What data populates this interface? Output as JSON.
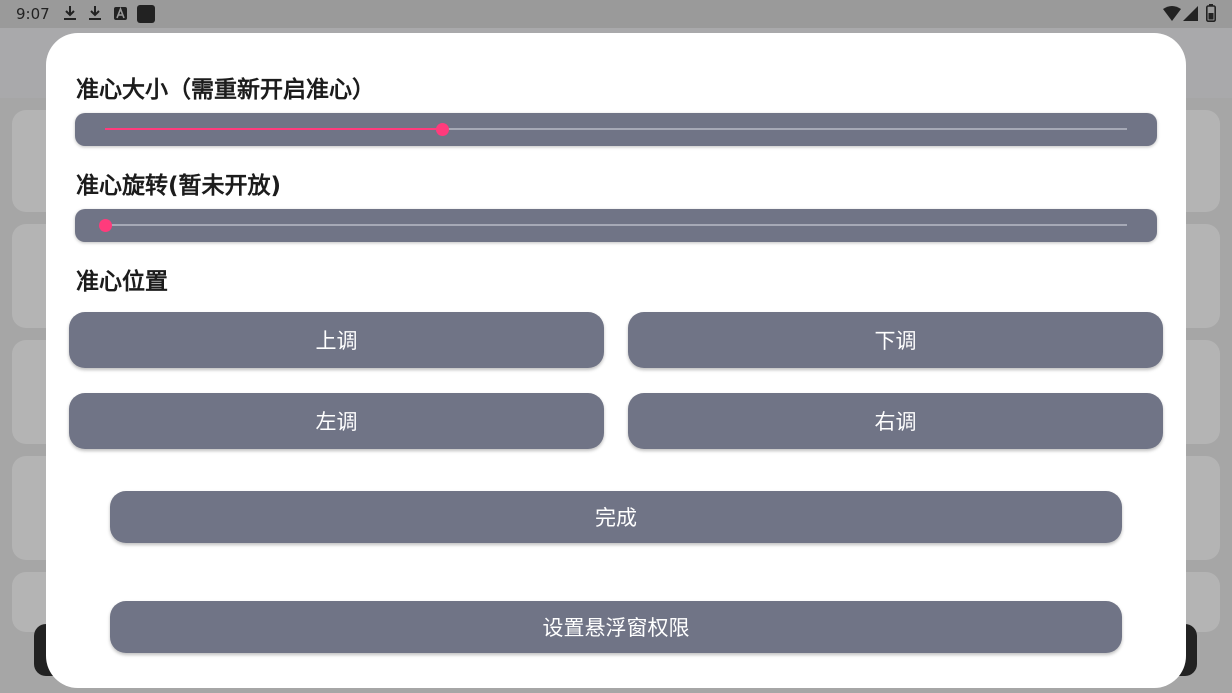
{
  "status_bar": {
    "time": "9:07",
    "icons": [
      "download-icon",
      "download-icon",
      "a-notification-icon",
      "square-notification-icon",
      "wifi-icon",
      "signal-icon",
      "battery-icon"
    ]
  },
  "dialog": {
    "size_title": "准心大小（需重新开启准心）",
    "size_slider_value": 0.33,
    "rotation_title": "准心旋转(暂未开放)",
    "rotation_slider_value": 0.0,
    "position_title": "准心位置",
    "up_label": "上调",
    "down_label": "下调",
    "left_label": "左调",
    "right_label": "右调",
    "done_label": "完成",
    "overlay_permission_label": "设置悬浮窗权限"
  },
  "colors": {
    "accent": "#ff3b7c",
    "button_bg": "#707486",
    "dialog_bg": "#ffffff"
  }
}
